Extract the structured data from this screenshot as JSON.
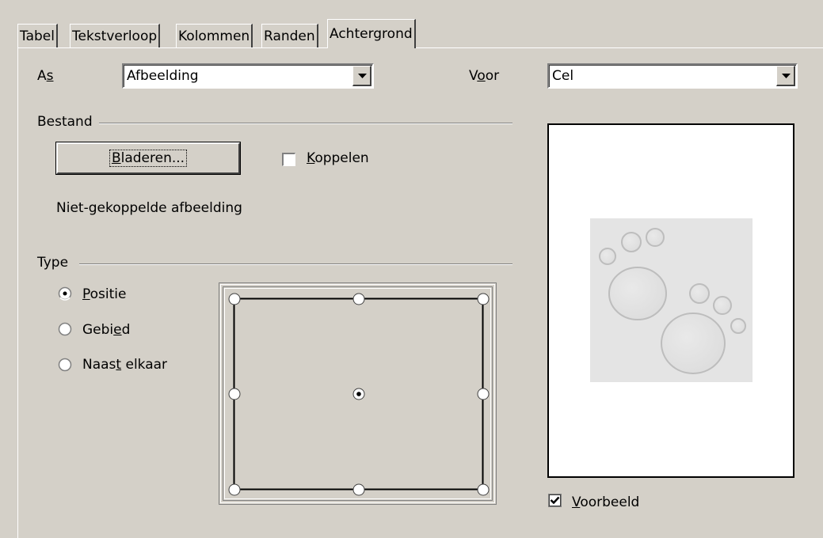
{
  "tabs": [
    {
      "label": "Tabel"
    },
    {
      "label": "Tekstverloop"
    },
    {
      "label": "Kolommen"
    },
    {
      "label": "Randen"
    },
    {
      "label": "Achtergrond",
      "active": true
    }
  ],
  "as_label_pre": "A",
  "as_label_key": "s",
  "as_value": "Afbeelding",
  "voor_label_pre": "V",
  "voor_label_key": "o",
  "voor_label_post": "or",
  "voor_value": "Cel",
  "file_section": "Bestand",
  "browse_key": "B",
  "browse_rest": "laderen...",
  "link_key": "K",
  "link_rest": "oppelen",
  "link_checked": false,
  "unlinked_text": "Niet-gekoppelde afbeelding",
  "type_section": "Type",
  "type_options": [
    {
      "pre": "",
      "key": "P",
      "post": "ositie",
      "selected": true
    },
    {
      "pre": "Gebi",
      "key": "e",
      "post": "d",
      "selected": false
    },
    {
      "pre": "Naas",
      "key": "t",
      "post": " elkaar",
      "selected": false
    }
  ],
  "position_selected": "center",
  "preview_key": "V",
  "preview_rest": "oorbeeld",
  "preview_checked": true
}
